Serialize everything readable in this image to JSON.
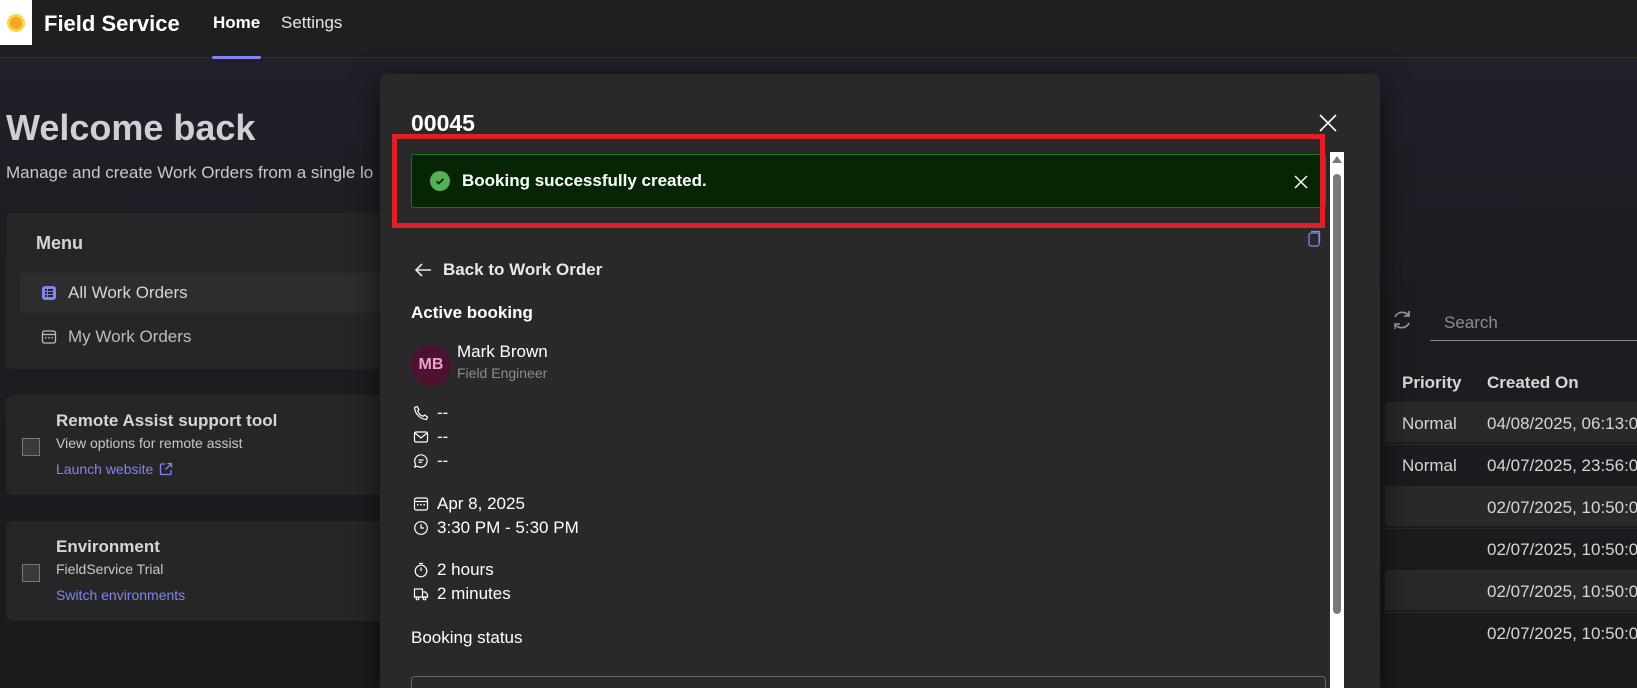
{
  "app": {
    "title": "Field Service",
    "nav": [
      {
        "label": "Home",
        "active": true
      },
      {
        "label": "Settings",
        "active": false
      }
    ]
  },
  "home": {
    "welcome_title": "Welcome back",
    "welcome_subtitle": "Manage and create Work Orders from a single lo",
    "menu": {
      "title": "Menu",
      "items": [
        {
          "label": "All Work Orders",
          "icon": "list-icon",
          "active": true
        },
        {
          "label": "My Work Orders",
          "icon": "calendar-icon",
          "active": false
        }
      ]
    },
    "cards": [
      {
        "title": "Remote Assist support tool",
        "subtitle": "View options for remote assist",
        "link": "Launch website"
      },
      {
        "title": "Environment",
        "subtitle": "FieldService Trial",
        "link": "Switch environments"
      }
    ],
    "search": {
      "placeholder": "Search"
    },
    "table": {
      "headers": [
        "Priority",
        "Created On"
      ],
      "rows": [
        {
          "priority": "Normal",
          "created_on": "04/08/2025, 06:13:0"
        },
        {
          "priority": "Normal",
          "created_on": "04/07/2025, 23:56:0"
        },
        {
          "priority": "",
          "created_on": "02/07/2025, 10:50:0"
        },
        {
          "priority": "",
          "created_on": "02/07/2025, 10:50:0"
        },
        {
          "priority": "",
          "created_on": "02/07/2025, 10:50:0"
        },
        {
          "priority": "",
          "created_on": "02/07/2025, 10:50:0"
        }
      ]
    }
  },
  "modal": {
    "title": "00045",
    "toast": {
      "message": "Booking successfully created.",
      "status_color": "#107c10"
    },
    "back_label": "Back to Work Order",
    "active_booking_label": "Active booking",
    "resource": {
      "initials": "MB",
      "name": "Mark Brown",
      "role": "Field Engineer"
    },
    "contact": {
      "phone": "--",
      "email": "--",
      "chat": "--"
    },
    "schedule": {
      "date": "Apr 8, 2025",
      "time": "3:30 PM - 5:30 PM"
    },
    "duration": {
      "estimated": "2 hours",
      "travel": "2 minutes"
    },
    "booking_status_label": "Booking status"
  },
  "colors": {
    "accent": "#7f85f5",
    "highlight": "#e01f26",
    "success_bg": "#052505"
  }
}
